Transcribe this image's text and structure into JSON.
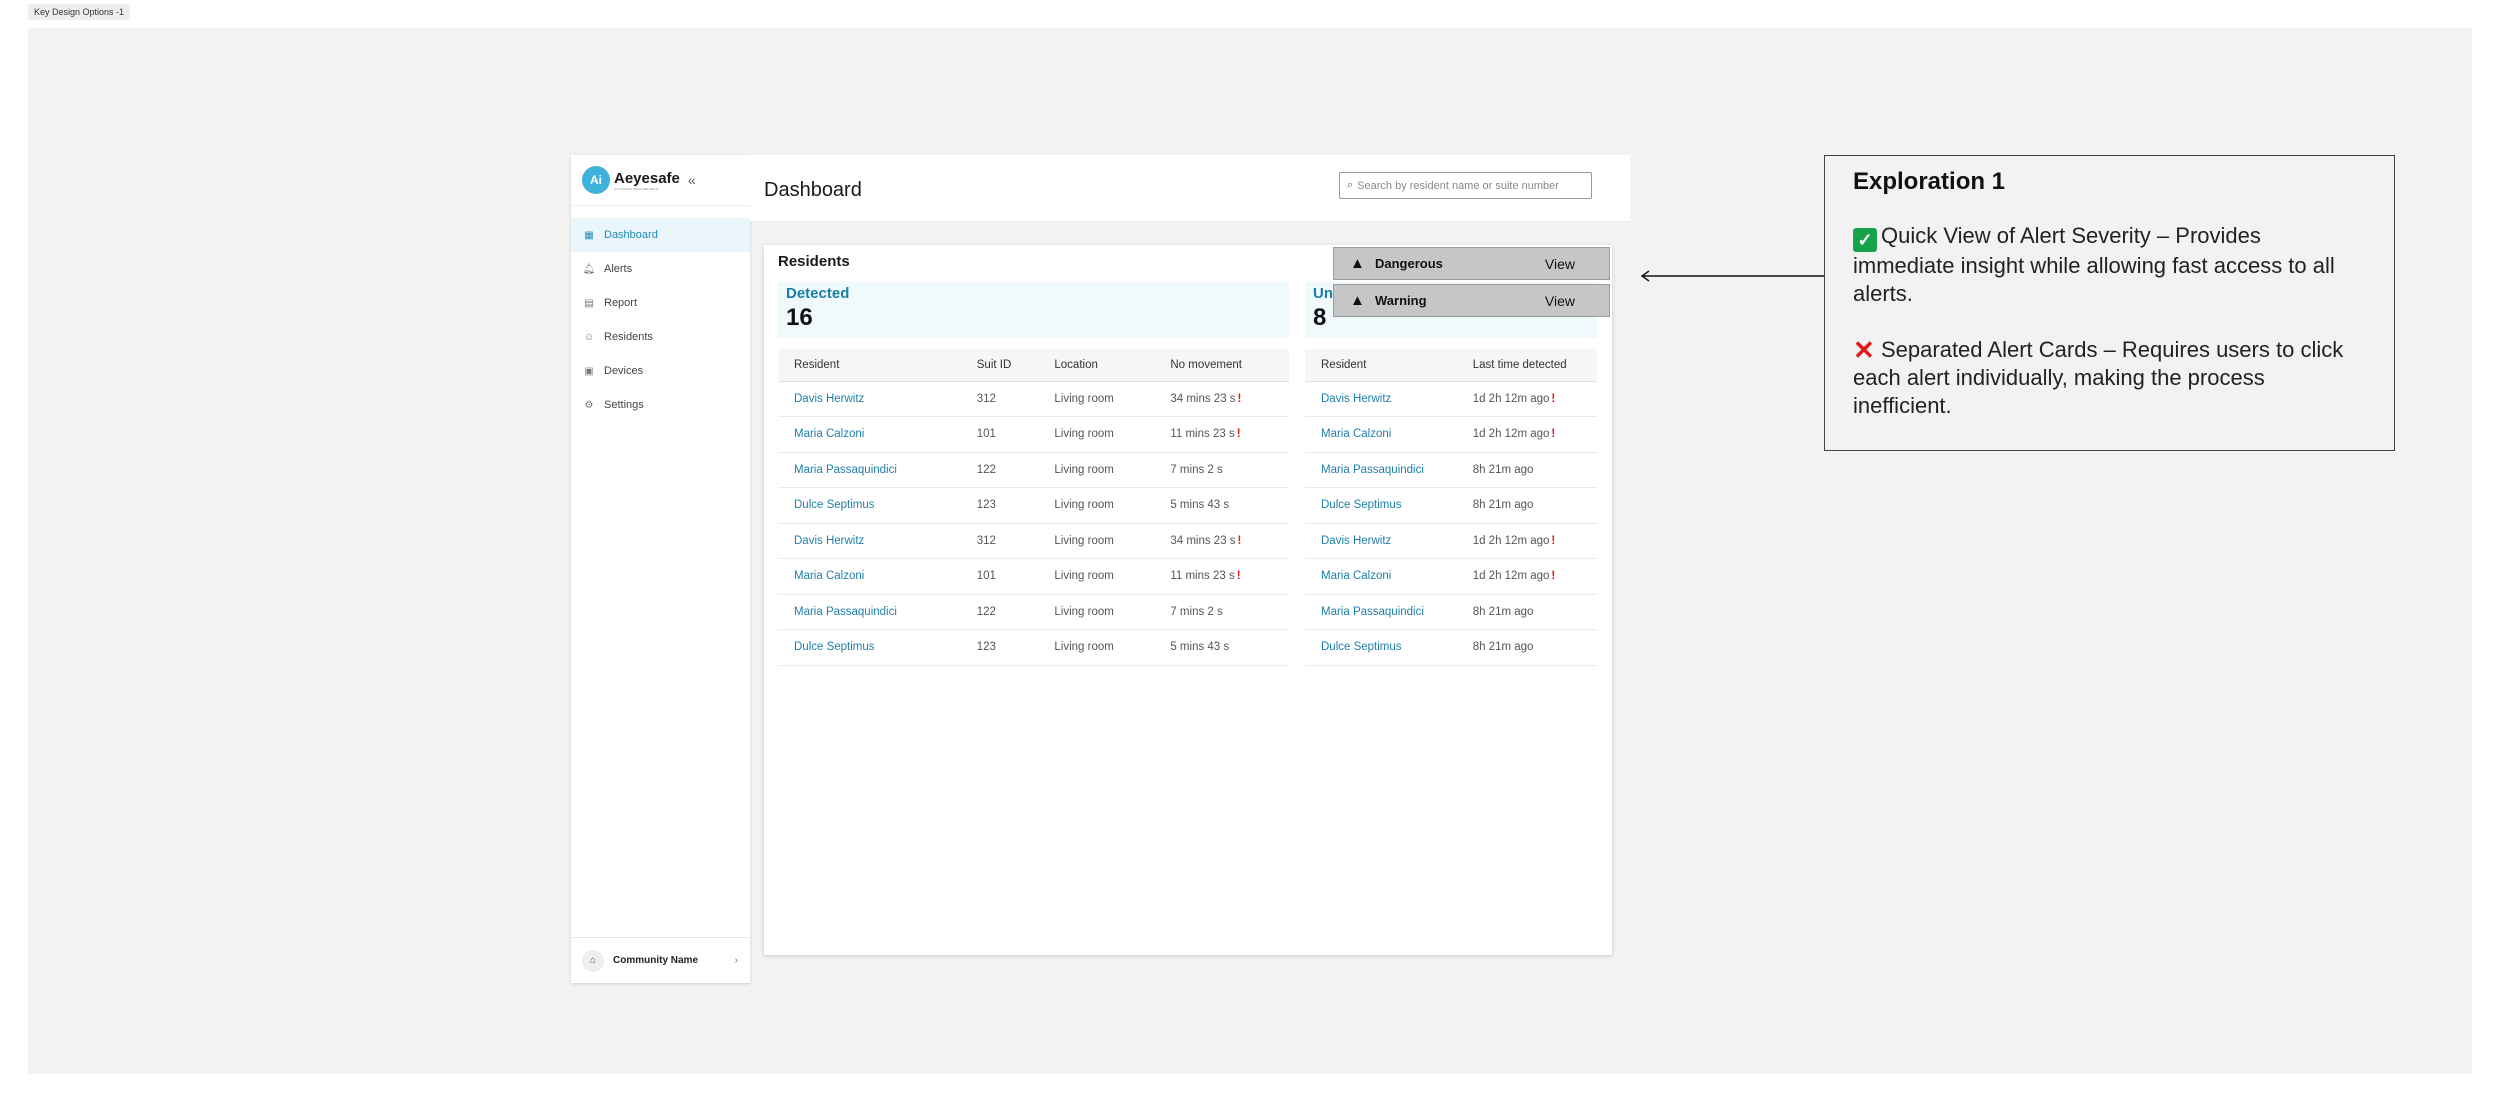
{
  "frame": {
    "label": "Key Design Options -1"
  },
  "sidebar": {
    "brand_mark": "Ai",
    "brand_name": "Aeyesafe",
    "brand_tag": "ACCURATE SAFE RELIABLE",
    "collapse_icon": "«",
    "items": [
      {
        "label": "Dashboard",
        "icon": "grid-icon",
        "active": true
      },
      {
        "label": "Alerts",
        "icon": "bell-icon"
      },
      {
        "label": "Report",
        "icon": "document-icon"
      },
      {
        "label": "Residents",
        "icon": "person-icon"
      },
      {
        "label": "Devices",
        "icon": "device-icon"
      },
      {
        "label": "Settings",
        "icon": "gear-icon"
      }
    ],
    "community": {
      "label": "Community Name",
      "icon": "building-icon"
    }
  },
  "header": {
    "title": "Dashboard",
    "search_placeholder": "Search by resident name or suite number"
  },
  "residents": {
    "title": "Residents",
    "detected": {
      "label": "Detected",
      "count": "16",
      "columns": [
        "Resident",
        "Suit ID",
        "Location",
        "No movement"
      ],
      "rows": [
        {
          "name": "Davis Herwitz",
          "suit": "312",
          "location": "Living room",
          "movement": "34 mins 23 s",
          "alert": true
        },
        {
          "name": "Maria Calzoni",
          "suit": "101",
          "location": "Living room",
          "movement": "11 mins 23 s",
          "alert": true
        },
        {
          "name": "Maria Passaquindici",
          "suit": "122",
          "location": "Living room",
          "movement": "7 mins 2 s",
          "alert": false
        },
        {
          "name": "Dulce Septimus",
          "suit": "123",
          "location": "Living room",
          "movement": "5 mins 43 s",
          "alert": false
        },
        {
          "name": "Davis Herwitz",
          "suit": "312",
          "location": "Living room",
          "movement": "34 mins 23 s",
          "alert": true
        },
        {
          "name": "Maria Calzoni",
          "suit": "101",
          "location": "Living room",
          "movement": "11 mins 23 s",
          "alert": true
        },
        {
          "name": "Maria Passaquindici",
          "suit": "122",
          "location": "Living room",
          "movement": "7 mins 2 s",
          "alert": false
        },
        {
          "name": "Dulce Septimus",
          "suit": "123",
          "location": "Living room",
          "movement": "5 mins 43 s",
          "alert": false
        }
      ]
    },
    "undetected": {
      "label": "Un",
      "count": "8",
      "columns": [
        "Resident",
        "Last time detected"
      ],
      "rows": [
        {
          "name": "Davis Herwitz",
          "last": "1d 2h 12m ago",
          "alert": true
        },
        {
          "name": "Maria Calzoni",
          "last": "1d 2h 12m ago",
          "alert": true
        },
        {
          "name": "Maria Passaquindici",
          "last": "8h 21m ago",
          "alert": false
        },
        {
          "name": "Dulce Septimus",
          "last": "8h 21m ago",
          "alert": false
        },
        {
          "name": "Davis Herwitz",
          "last": "1d 2h 12m ago",
          "alert": true
        },
        {
          "name": "Maria Calzoni",
          "last": "1d 2h 12m ago",
          "alert": true
        },
        {
          "name": "Maria Passaquindici",
          "last": "8h 21m ago",
          "alert": false
        },
        {
          "name": "Dulce Septimus",
          "last": "8h 21m ago",
          "alert": false
        }
      ]
    },
    "alert_mark": "!"
  },
  "alerts": [
    {
      "label": "Dangerous",
      "action": "View",
      "icon": "warning-icon"
    },
    {
      "label": "Warning",
      "action": "View",
      "icon": "warning-icon"
    }
  ],
  "note": {
    "title": "Exploration 1",
    "pro": "Quick View of Alert Severity – Provides immediate insight while allowing fast access to all alerts.",
    "con": "Separated Alert Cards – Requires users to click each alert individually, making the process inefficient.",
    "pro_icon": "check-mark-icon",
    "con_icon": "cross-mark-icon"
  },
  "colors": {
    "accent": "#1e8cbe",
    "link": "#1f7fa8",
    "alert": "#e01919",
    "stat_bg": "#f0fafc"
  }
}
